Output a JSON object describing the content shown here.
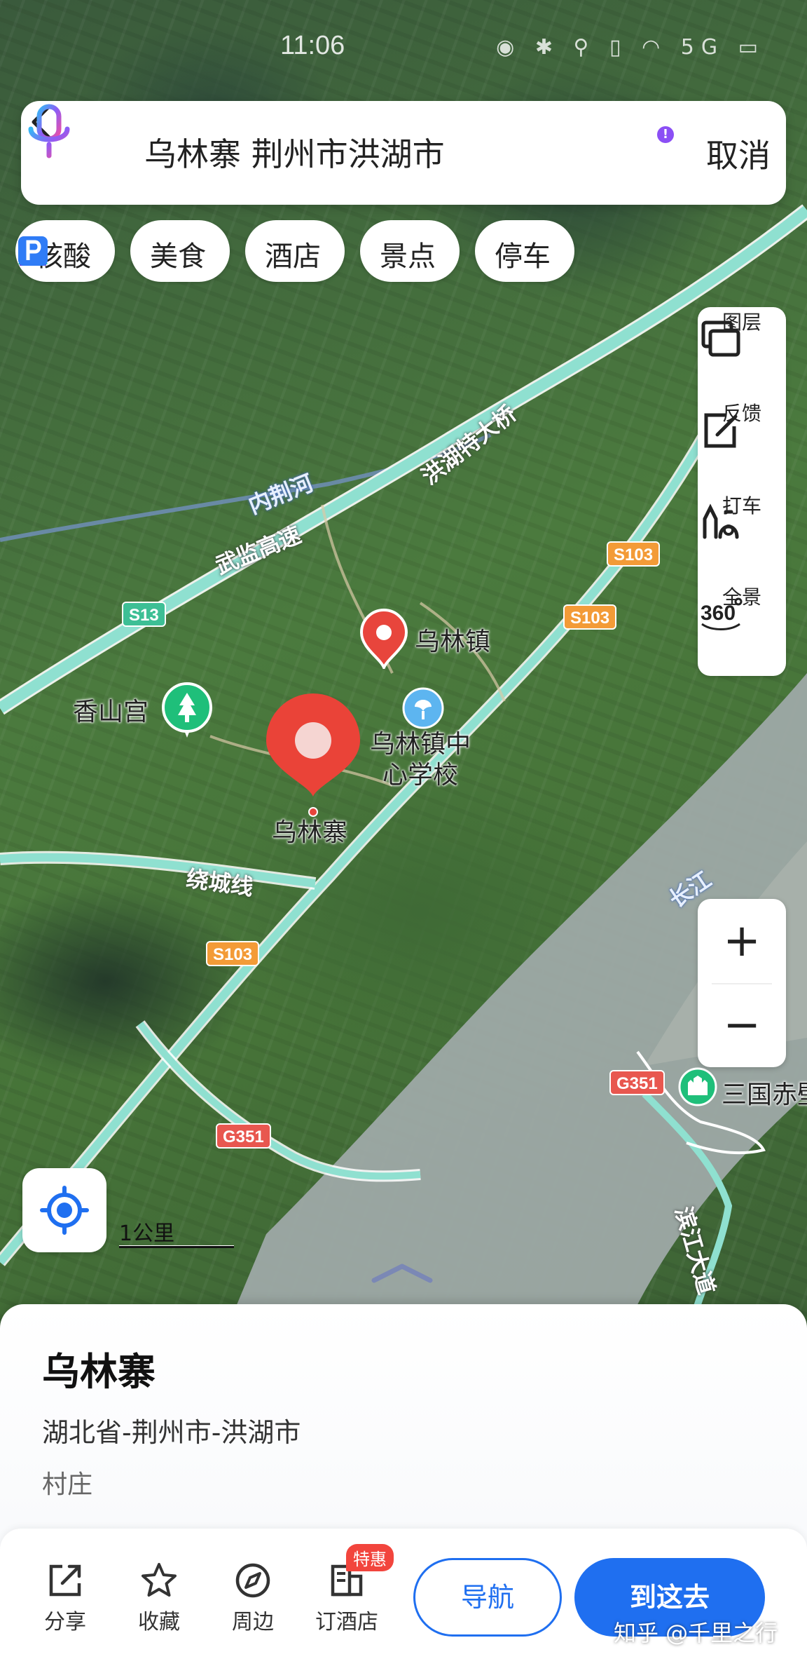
{
  "status_bar": {
    "time": "11:06",
    "icons": "◉ ✱ ⚲ ▯ ◠ 5G ▭"
  },
  "search": {
    "query": "乌林寨 荆州市洪湖市",
    "cancel_label": "取消",
    "mic_badge": "!"
  },
  "categories": [
    {
      "label": "核酸",
      "icon": "swab-icon",
      "color": "#e8453c"
    },
    {
      "label": "美食",
      "icon": "food-icon",
      "color": "#f5a623"
    },
    {
      "label": "酒店",
      "icon": "hotel-icon",
      "color": "#7a5cf0"
    },
    {
      "label": "景点",
      "icon": "scenic-icon",
      "color": "#1fc6a0"
    },
    {
      "label": "停车",
      "icon": "parking-icon",
      "color": "#2f7cf6"
    }
  ],
  "tools": [
    {
      "label": "图层",
      "icon": "layers-icon"
    },
    {
      "label": "反馈",
      "icon": "feedback-icon"
    },
    {
      "label": "打车",
      "icon": "taxi-icon"
    },
    {
      "label": "全景",
      "icon": "panorama-360-icon"
    }
  ],
  "zoom": {
    "in": "+",
    "out": "−"
  },
  "scale": {
    "label": "1公里"
  },
  "map_labels": {
    "town": "乌林镇",
    "xiangshan": "香山宫",
    "school_line1": "乌林镇中",
    "school_line2": "心学校",
    "selected": "乌林寨",
    "sanguo": "三国赤壁",
    "neijing": "内荆河",
    "honghu_bridge": "洪湖特大桥",
    "wujian": "武监高速",
    "raocheng": "绕城线",
    "changjiang": "长江",
    "bingang": "滨江大道"
  },
  "road_badges": {
    "s13": "S13",
    "s103a": "S103",
    "s103b": "S103",
    "s103c": "S103",
    "g351a": "G351",
    "g351b": "G351"
  },
  "place": {
    "title": "乌林寨",
    "address": "湖北省-荆州市-洪湖市",
    "type": "村庄"
  },
  "actions": [
    {
      "label": "分享",
      "icon": "share-icon"
    },
    {
      "label": "收藏",
      "icon": "star-icon"
    },
    {
      "label": "周边",
      "icon": "compass-icon"
    },
    {
      "label": "订酒店",
      "icon": "hotel-book-icon"
    }
  ],
  "deal_badge": "特惠",
  "nav_label": "导航",
  "go_label": "到这去",
  "watermark": "知乎 @千里之行",
  "colors": {
    "primary": "#1f6ff0",
    "road": "#8fe0d0",
    "river": "#9aa8a8",
    "pin": "#e8453c"
  }
}
